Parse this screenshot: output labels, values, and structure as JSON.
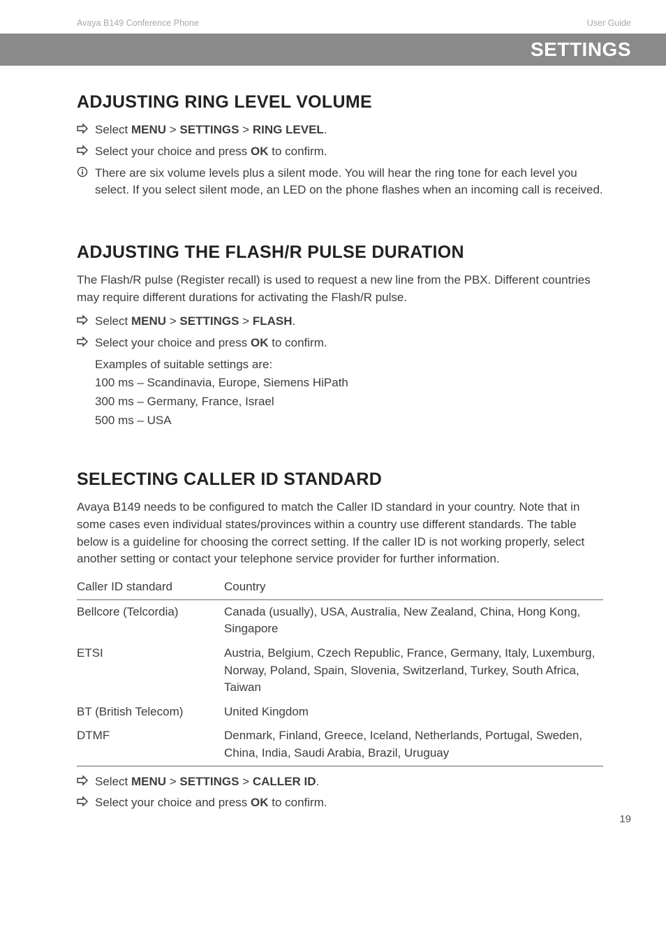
{
  "header": {
    "product": "Avaya B149 Conference Phone",
    "doc_type": "User Guide",
    "band_title": "SETTINGS"
  },
  "sections": {
    "ring": {
      "title": "ADJUSTING RING LEVEL VOLUME",
      "step1_pre": "Select ",
      "menu": "MENU",
      "gt": " > ",
      "settings": "SETTINGS",
      "ringlevel": "RING LEVEL",
      "step1_post": ".",
      "step2_pre": "Select your choice and press ",
      "ok": "OK",
      "step2_post": " to confirm.",
      "info": "There are six volume levels plus a silent mode. You will hear the ring tone for each level you select. If you select silent mode, an LED on the phone flashes when an incoming call is received."
    },
    "flash": {
      "title": "ADJUSTING THE FLASH/R PULSE DURATION",
      "intro": "The Flash/R pulse (Register recall) is used to request a new line from the PBX. Different countries may require different durations for activating the Flash/R pulse.",
      "step1_pre": "Select ",
      "menu": "MENU",
      "gt": " > ",
      "settings": "SETTINGS",
      "flash": "FLASH",
      "step1_post": ".",
      "step2_pre": "Select your choice and press ",
      "ok": "OK",
      "step2_post": " to confirm.",
      "examples_label": "Examples of suitable settings are:",
      "ex1": "100 ms – Scandinavia, Europe, Siemens HiPath",
      "ex2": "300 ms – Germany, France, Israel",
      "ex3": "500 ms – USA"
    },
    "caller": {
      "title": "SELECTING CALLER ID STANDARD",
      "intro": "Avaya B149 needs to be configured to match the Caller ID standard in your country. Note that in some cases even individual states/provinces within a country use different standards. The table below is a guideline for choosing the correct setting. If the caller ID is not working properly, select another setting or contact your telephone service provider for further information.",
      "table": {
        "head_a": "Caller ID standard",
        "head_b": "Country",
        "rows": [
          {
            "a": "Bellcore (Telcordia)",
            "b": "Canada (usually), USA, Australia, New Zealand, China, Hong Kong, Singapore"
          },
          {
            "a": "ETSI",
            "b": "Austria, Belgium, Czech Republic, France, Germany, Italy, Luxemburg, Norway, Poland, Spain, Slovenia, Switzerland, Turkey, South Africa, Taiwan"
          },
          {
            "a": "BT (British Telecom)",
            "b": "United Kingdom"
          },
          {
            "a": "DTMF",
            "b": "Denmark, Finland, Greece, Iceland, Netherlands, Portugal, Sweden, China, India, Saudi Arabia, Brazil, Uruguay"
          }
        ]
      },
      "step1_pre": "Select ",
      "menu": "MENU",
      "gt": " > ",
      "settings": "SETTINGS",
      "callerid": "CALLER ID",
      "step1_post": ".",
      "step2_pre": "Select your choice and press ",
      "ok": "OK",
      "step2_post": " to confirm."
    }
  },
  "page_number": "19"
}
